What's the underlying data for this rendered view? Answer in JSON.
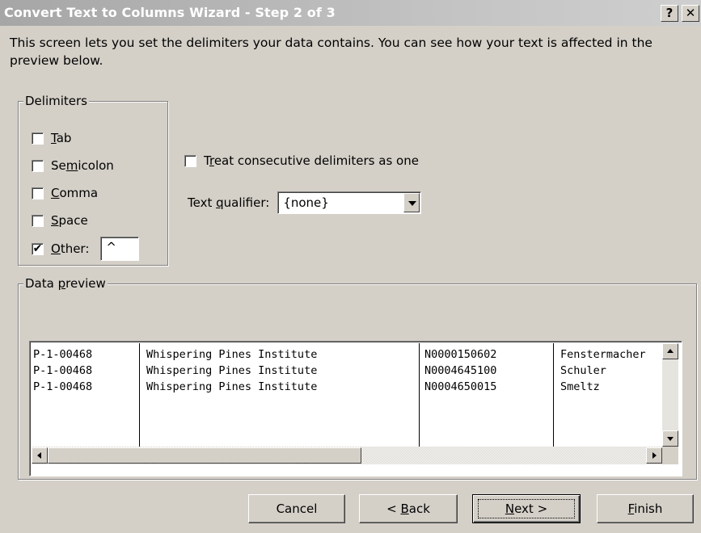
{
  "window": {
    "title": "Convert Text to Columns Wizard - Step 2 of 3",
    "help_glyph": "?",
    "close_glyph": "✕"
  },
  "description": "This screen lets you set the delimiters your data contains.  You can see how your text is affected in the preview below.",
  "delimiters": {
    "legend": "Delimiters",
    "options": [
      {
        "label_pre": "",
        "label_ul": "T",
        "label_post": "ab",
        "checked": false
      },
      {
        "label_pre": "Se",
        "label_ul": "m",
        "label_post": "icolon",
        "checked": false
      },
      {
        "label_pre": "",
        "label_ul": "C",
        "label_post": "omma",
        "checked": false
      },
      {
        "label_pre": "",
        "label_ul": "S",
        "label_post": "pace",
        "checked": false
      },
      {
        "label_pre": "",
        "label_ul": "O",
        "label_post": "ther:",
        "checked": true
      }
    ],
    "other_value": "^",
    "check_glyph": "✔"
  },
  "consecutive": {
    "label_pre": "T",
    "label_ul": "r",
    "label_post": "eat consecutive delimiters as one",
    "checked": false
  },
  "qualifier": {
    "label_pre": "Text ",
    "label_ul": "q",
    "label_post": "ualifier:",
    "value": "{none}"
  },
  "preview": {
    "legend_pre": "Data ",
    "legend_ul": "p",
    "legend_post": "review",
    "columns": [
      [
        "P-1-00468",
        "P-1-00468",
        "P-1-00468"
      ],
      [
        "Whispering Pines Institute",
        "Whispering Pines Institute",
        "Whispering Pines Institute"
      ],
      [
        "N0000150602",
        "N0004645100",
        "N0004650015"
      ],
      [
        "Fenstermacher",
        "Schuler",
        "Smeltz"
      ]
    ]
  },
  "buttons": {
    "cancel": "Cancel",
    "back_pre": "< ",
    "back_ul": "B",
    "back_post": "ack",
    "next_ul": "N",
    "next_post": "ext >",
    "finish_ul": "F",
    "finish_post": "inish"
  }
}
